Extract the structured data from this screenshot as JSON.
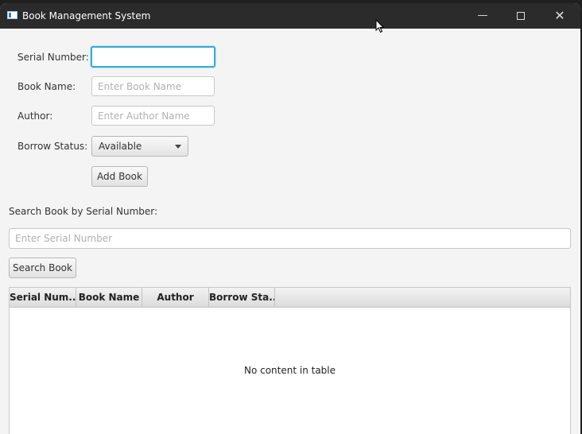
{
  "window": {
    "title": "Book Management System",
    "app_icon": "java-app-icon"
  },
  "titlebar": {
    "minimize_icon": "minimize-icon",
    "maximize_icon": "maximize-icon",
    "close_icon": "close-icon",
    "minimize_glyph": "—",
    "close_glyph": "✕"
  },
  "form": {
    "serial_label": "Serial Number:",
    "serial_value": "",
    "book_name_label": "Book Name:",
    "book_name_placeholder": "Enter Book Name",
    "author_label": "Author:",
    "author_placeholder": "Enter Author Name",
    "borrow_status_label": "Borrow Status:",
    "borrow_status_selected": "Available",
    "add_button_label": "Add Book"
  },
  "search": {
    "label": "Search Book by Serial Number:",
    "placeholder": "Enter Serial Number",
    "button_label": "Search Book"
  },
  "table": {
    "columns": [
      "Serial Num...",
      "Book Name",
      "Author",
      "Borrow Sta..."
    ],
    "rows": [],
    "empty_message": "No content in table"
  },
  "colors": {
    "focus_accent": "#39a9d9",
    "titlebar": "#2b2b2b",
    "background": "#f4f4f4"
  }
}
